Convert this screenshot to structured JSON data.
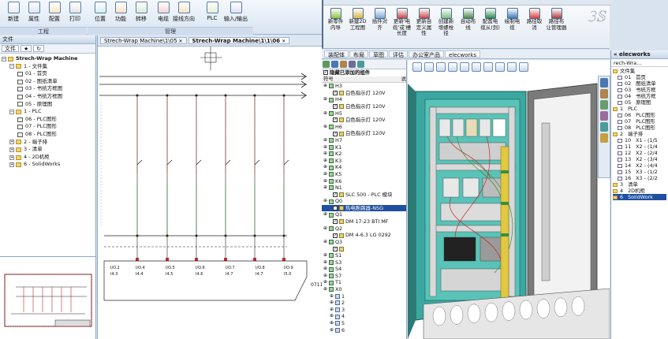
{
  "ribbon_left": {
    "buttons": [
      {
        "label": "新建",
        "icon": "new-icon"
      },
      {
        "label": "属性",
        "icon": "properties-icon"
      },
      {
        "label": "配置",
        "icon": "configure-icon"
      },
      {
        "label": "打印",
        "icon": "print-icon"
      },
      {
        "label": "位置",
        "icon": "location-icon"
      },
      {
        "label": "功能",
        "icon": "function-icon"
      },
      {
        "label": "转移",
        "icon": "transfer-icon"
      },
      {
        "label": "电缆",
        "icon": "cable-icon"
      },
      {
        "label": "接线方向",
        "icon": "wiring-direction-icon"
      },
      {
        "label": "PLC",
        "icon": "plc-icon"
      },
      {
        "label": "输入/输出",
        "icon": "io-icon"
      }
    ],
    "groups": [
      "工程",
      "管理"
    ]
  },
  "left_panel": {
    "title": "文件",
    "tab_label": "文件",
    "tree": [
      {
        "label": "Strech-Wrap Machine",
        "level": 0,
        "kind": "root"
      },
      {
        "label": "1 - 文件集",
        "level": 1,
        "kind": "folder"
      },
      {
        "label": "01 - 首页",
        "level": 2,
        "kind": "doc"
      },
      {
        "label": "02 - 图纸清单",
        "level": 2,
        "kind": "doc"
      },
      {
        "label": "03 - 书统方框图",
        "level": 2,
        "kind": "doc"
      },
      {
        "label": "04 - 书统方框图",
        "level": 2,
        "kind": "doc"
      },
      {
        "label": "05 - 原理图",
        "level": 2,
        "kind": "doc"
      },
      {
        "label": "1 - PLC",
        "level": 1,
        "kind": "folder"
      },
      {
        "label": "06 - PLC图形",
        "level": 2,
        "kind": "doc"
      },
      {
        "label": "07 - PLC图形",
        "level": 2,
        "kind": "doc"
      },
      {
        "label": "08 - PLC图形",
        "level": 2,
        "kind": "doc"
      },
      {
        "label": "2 - 端子排",
        "level": 1,
        "kind": "folder"
      },
      {
        "label": "3 - 清单",
        "level": 1,
        "kind": "folder"
      },
      {
        "label": "4 - 2D机柜",
        "level": 1,
        "kind": "folder"
      },
      {
        "label": "6 - SolidWorks",
        "level": 1,
        "kind": "folder"
      }
    ]
  },
  "schematic": {
    "tabs": [
      "Strech-Wrap Machine\\1\\05",
      "Strech-Wrap Machine\\1\\1\\06"
    ],
    "io_labels": [
      "I/O.2",
      "I/O.4",
      "I/O.5",
      "I/O.6",
      "I/O.7",
      "I/O.8",
      "I/O.9"
    ],
    "address_labels": [
      "I4.3",
      "I4.4",
      "I4.5",
      "I4.6",
      "I4.7",
      "I4.7",
      "I5.0",
      "I5.1"
    ],
    "side_label": "0711"
  },
  "sw_ribbon": {
    "buttons": [
      {
        "label": "新零件\n内导",
        "icon": "new-part-icon"
      },
      {
        "label": "新建2D\n工程图",
        "icon": "new-drawing-icon"
      },
      {
        "label": "插件对\n齐",
        "icon": "align-icon"
      },
      {
        "label": "更新'电\n缆'或'槽\n长度",
        "icon": "update-cable-icon"
      },
      {
        "label": "更新自\n定义属\n性",
        "icon": "custom-props-icon"
      },
      {
        "label": "创建新\n增螺栓\n径",
        "icon": "bolt-icon"
      },
      {
        "label": "自动布\n线",
        "icon": "auto-route-icon"
      },
      {
        "label": "配置电\n缆从(到)",
        "icon": "cable-config-icon"
      },
      {
        "label": "绘制电\n缆",
        "icon": "draw-cable-icon"
      },
      {
        "label": "路径取\n消",
        "icon": "route-cancel-icon"
      },
      {
        "label": "路径布\n让管理器",
        "icon": "route-manager-icon"
      }
    ]
  },
  "sw_tabs": [
    "装配体",
    "布局",
    "草图",
    "评估",
    "办公室产品",
    "elecworks"
  ],
  "feature_tree": {
    "header": "隐藏已添加的组件",
    "col_label": "符号",
    "col_desc": "说",
    "rows": [
      {
        "label": "H3",
        "kind": "node"
      },
      {
        "label": "白色指示灯 120V",
        "kind": "child"
      },
      {
        "label": "H4",
        "kind": "node"
      },
      {
        "label": "白色指示灯 120V",
        "kind": "child"
      },
      {
        "label": "H5",
        "kind": "node"
      },
      {
        "label": "白色指示灯 120V",
        "kind": "child"
      },
      {
        "label": "H6",
        "kind": "node"
      },
      {
        "label": "白色指示灯 120V",
        "kind": "child"
      },
      {
        "label": "H7",
        "kind": "node"
      },
      {
        "label": "K1",
        "kind": "node"
      },
      {
        "label": "K2",
        "kind": "node"
      },
      {
        "label": "K3",
        "kind": "node"
      },
      {
        "label": "K4",
        "kind": "node"
      },
      {
        "label": "K5",
        "kind": "node"
      },
      {
        "label": "K6",
        "kind": "node"
      },
      {
        "label": "N1",
        "kind": "node"
      },
      {
        "label": "SLC 500 - PLC 模块",
        "kind": "child"
      },
      {
        "label": "Q0",
        "kind": "node"
      },
      {
        "label": "热电断路器-NSG",
        "kind": "child-sel"
      },
      {
        "label": "Q1",
        "kind": "node"
      },
      {
        "label": "DM 17-23 BTI MF",
        "kind": "child"
      },
      {
        "label": "Q2",
        "kind": "node"
      },
      {
        "label": "DM 4-6.3 LG 0292",
        "kind": "child"
      },
      {
        "label": "Q3",
        "kind": "node"
      },
      {
        "label": "",
        "kind": "child"
      },
      {
        "label": "S1",
        "kind": "node"
      },
      {
        "label": "S3",
        "kind": "node"
      },
      {
        "label": "S4",
        "kind": "node"
      },
      {
        "label": "S7",
        "kind": "node"
      },
      {
        "label": "T1",
        "kind": "node"
      },
      {
        "label": "X0",
        "kind": "node"
      },
      {
        "label": "1",
        "kind": "term"
      },
      {
        "label": "2",
        "kind": "term"
      },
      {
        "label": "3",
        "kind": "term"
      },
      {
        "label": "4",
        "kind": "term"
      },
      {
        "label": "5",
        "kind": "term"
      },
      {
        "label": "6",
        "kind": "term"
      }
    ]
  },
  "ew_panel": {
    "title": "elecworks",
    "project": "rech-Wra...",
    "rows": [
      {
        "label": "文件集",
        "kind": "folder"
      },
      {
        "label": "首页",
        "kind": "doc",
        "num": "01"
      },
      {
        "label": "图纸清单",
        "kind": "doc",
        "num": "02"
      },
      {
        "label": "书统方框",
        "kind": "doc",
        "num": "03"
      },
      {
        "label": "书统方框",
        "kind": "doc",
        "num": "04"
      },
      {
        "label": "原理图",
        "kind": "doc",
        "num": "05"
      },
      {
        "label": "PLC",
        "kind": "folder",
        "num": "1"
      },
      {
        "label": "PLC图形",
        "kind": "doc",
        "num": "06"
      },
      {
        "label": "PLC图形",
        "kind": "doc",
        "num": "07"
      },
      {
        "label": "PLC图形",
        "kind": "doc",
        "num": "08"
      },
      {
        "label": "端子排",
        "kind": "folder",
        "num": "2"
      },
      {
        "label": "X1 - (1/5",
        "kind": "doc",
        "num": "10"
      },
      {
        "label": "X2 - (1/4",
        "kind": "doc",
        "num": "11"
      },
      {
        "label": "X2 - (2/4",
        "kind": "doc",
        "num": "12"
      },
      {
        "label": "X2 - (3/4",
        "kind": "doc",
        "num": "13"
      },
      {
        "label": "X2 - (4/4",
        "kind": "doc",
        "num": "14"
      },
      {
        "label": "X3 - (1/2",
        "kind": "doc",
        "num": "15"
      },
      {
        "label": "X3 - (2/2",
        "kind": "doc",
        "num": "16"
      },
      {
        "label": "清单",
        "kind": "folder",
        "num": "3"
      },
      {
        "label": "2D机柜",
        "kind": "folder",
        "num": "4"
      },
      {
        "label": "SolidWork",
        "kind": "folder-sel",
        "num": "6"
      }
    ]
  },
  "colors": {
    "accent": "#1f4fa0",
    "ribbon": "#d8e4f2",
    "panel_teal": "#3aa8a0",
    "rail_yellow": "#e1c83c",
    "wire_red": "#c22a2a",
    "wire_green": "#3c8c3c"
  }
}
